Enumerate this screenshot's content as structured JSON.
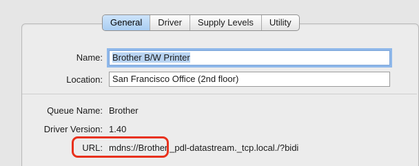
{
  "tabs": [
    {
      "label": "General",
      "active": true
    },
    {
      "label": "Driver",
      "active": false
    },
    {
      "label": "Supply Levels",
      "active": false
    },
    {
      "label": "Utility",
      "active": false
    }
  ],
  "form": {
    "name_label": "Name:",
    "name_value": "Brother B/W Printer",
    "location_label": "Location:",
    "location_value": "San Francisco Office (2nd floor)"
  },
  "info": {
    "queue_label": "Queue Name:",
    "queue_value": "Brother",
    "driver_label": "Driver Version:",
    "driver_value": "1.40",
    "url_label": "URL:",
    "url_value": "mdns://Brother._pdl-datastream._tcp.local./?bidi"
  },
  "colors": {
    "highlight": "#e8311c",
    "tab_active": "#a9cdf2",
    "focus_ring": "#8fb8ea"
  }
}
